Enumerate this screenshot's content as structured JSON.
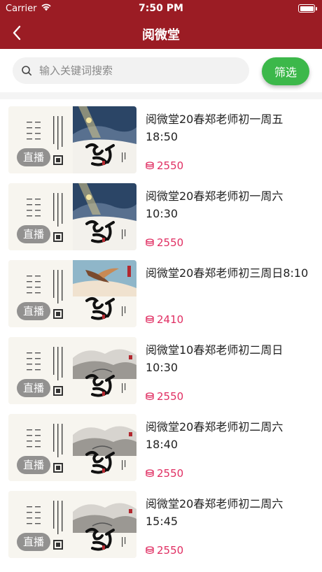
{
  "status_bar": {
    "carrier": "Carrier",
    "time": "7:50 PM"
  },
  "nav": {
    "title": "阅微堂"
  },
  "search": {
    "placeholder": "输入关键词搜索",
    "value": ""
  },
  "filter_label": "筛选",
  "badge_label": "直播",
  "colors": {
    "brand_red": "#9b1c24",
    "filter_green": "#3cb84a",
    "price_pink": "#e02e62"
  },
  "courses": [
    {
      "title": "阅微堂20春郑老师初一周五18:50",
      "price": "2550",
      "cover": "blue-night"
    },
    {
      "title": "阅微堂20春郑老师初一周六10:30",
      "price": "2550",
      "cover": "blue-night"
    },
    {
      "title": "阅微堂20春郑老师初三周日8:10",
      "price": "2410",
      "cover": "crane"
    },
    {
      "title": "阅微堂10春郑老师初二周日10:30",
      "price": "2550",
      "cover": "ink-mountain"
    },
    {
      "title": "阅微堂20春郑老师初二周六18:40",
      "price": "2550",
      "cover": "ink-mountain"
    },
    {
      "title": "阅微堂20春郑老师初二周六15:45",
      "price": "2550",
      "cover": "ink-mountain"
    }
  ]
}
